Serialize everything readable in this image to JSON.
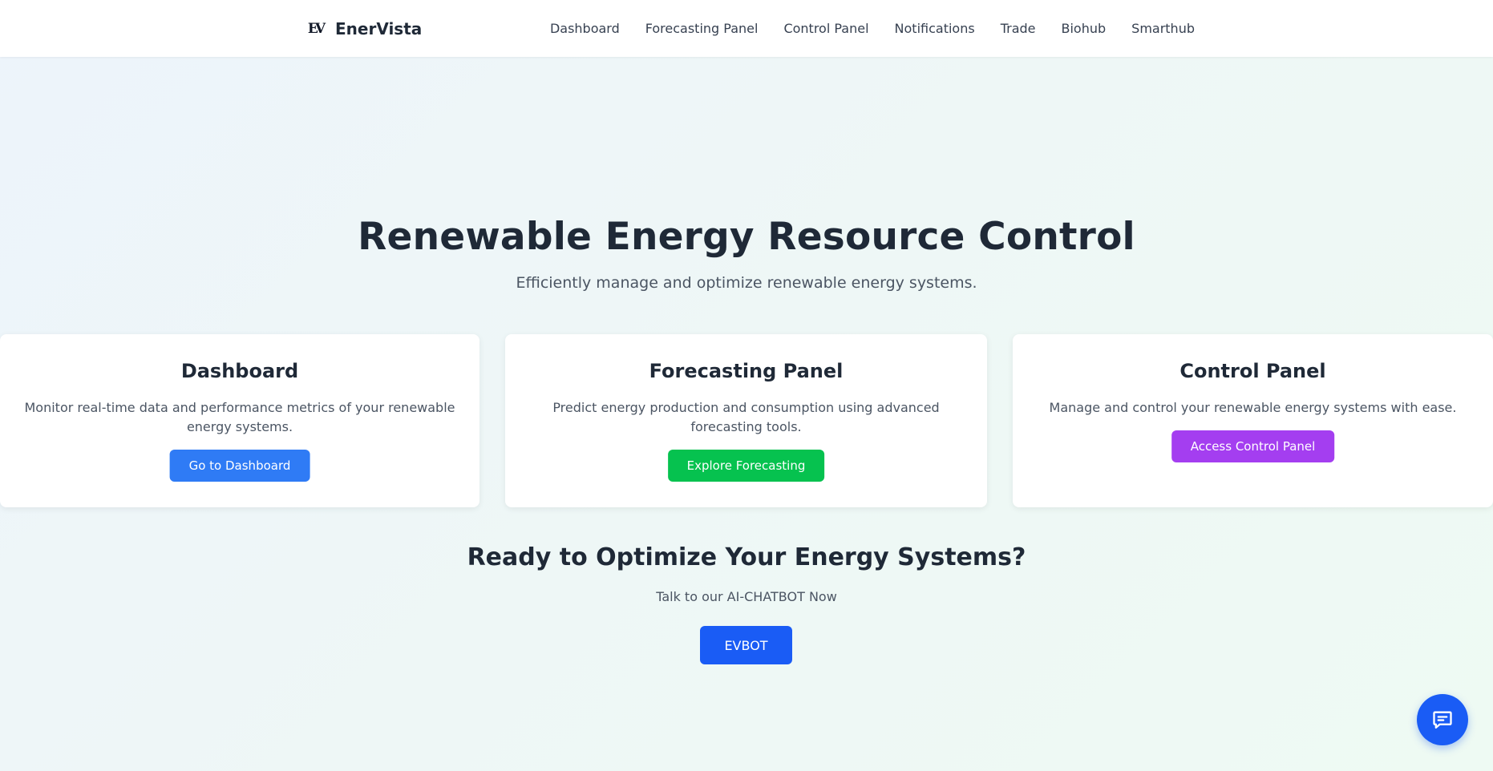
{
  "nav": {
    "brand": "EnerVista",
    "logo_text": "EV",
    "links": [
      "Dashboard",
      "Forecasting Panel",
      "Control Panel",
      "Notifications",
      "Trade",
      "Biohub",
      "Smarthub"
    ]
  },
  "hero": {
    "title": "Renewable Energy Resource Control",
    "subtitle": "Efficiently manage and optimize renewable energy systems."
  },
  "cards": [
    {
      "title": "Dashboard",
      "description": "Monitor real-time data and performance metrics of your renewable energy systems.",
      "button": "Go to Dashboard",
      "button_color": "#2f7bf5"
    },
    {
      "title": "Forecasting Panel",
      "description": "Predict energy production and consumption using advanced forecasting tools.",
      "button": "Explore Forecasting",
      "button_color": "#06c24f"
    },
    {
      "title": "Control Panel",
      "description": "Manage and control your renewable energy systems with ease.",
      "button": "Access Control Panel",
      "button_color": "#a43ef0"
    }
  ],
  "cta": {
    "title": "Ready to Optimize Your Energy Systems?",
    "subtitle": "Talk to our AI-CHATBOT Now",
    "button": "EVBOT",
    "button_color": "#1a5cf5"
  },
  "chat_fab": {
    "icon": "chat-bubble-icon",
    "color": "#1a5cf5"
  }
}
